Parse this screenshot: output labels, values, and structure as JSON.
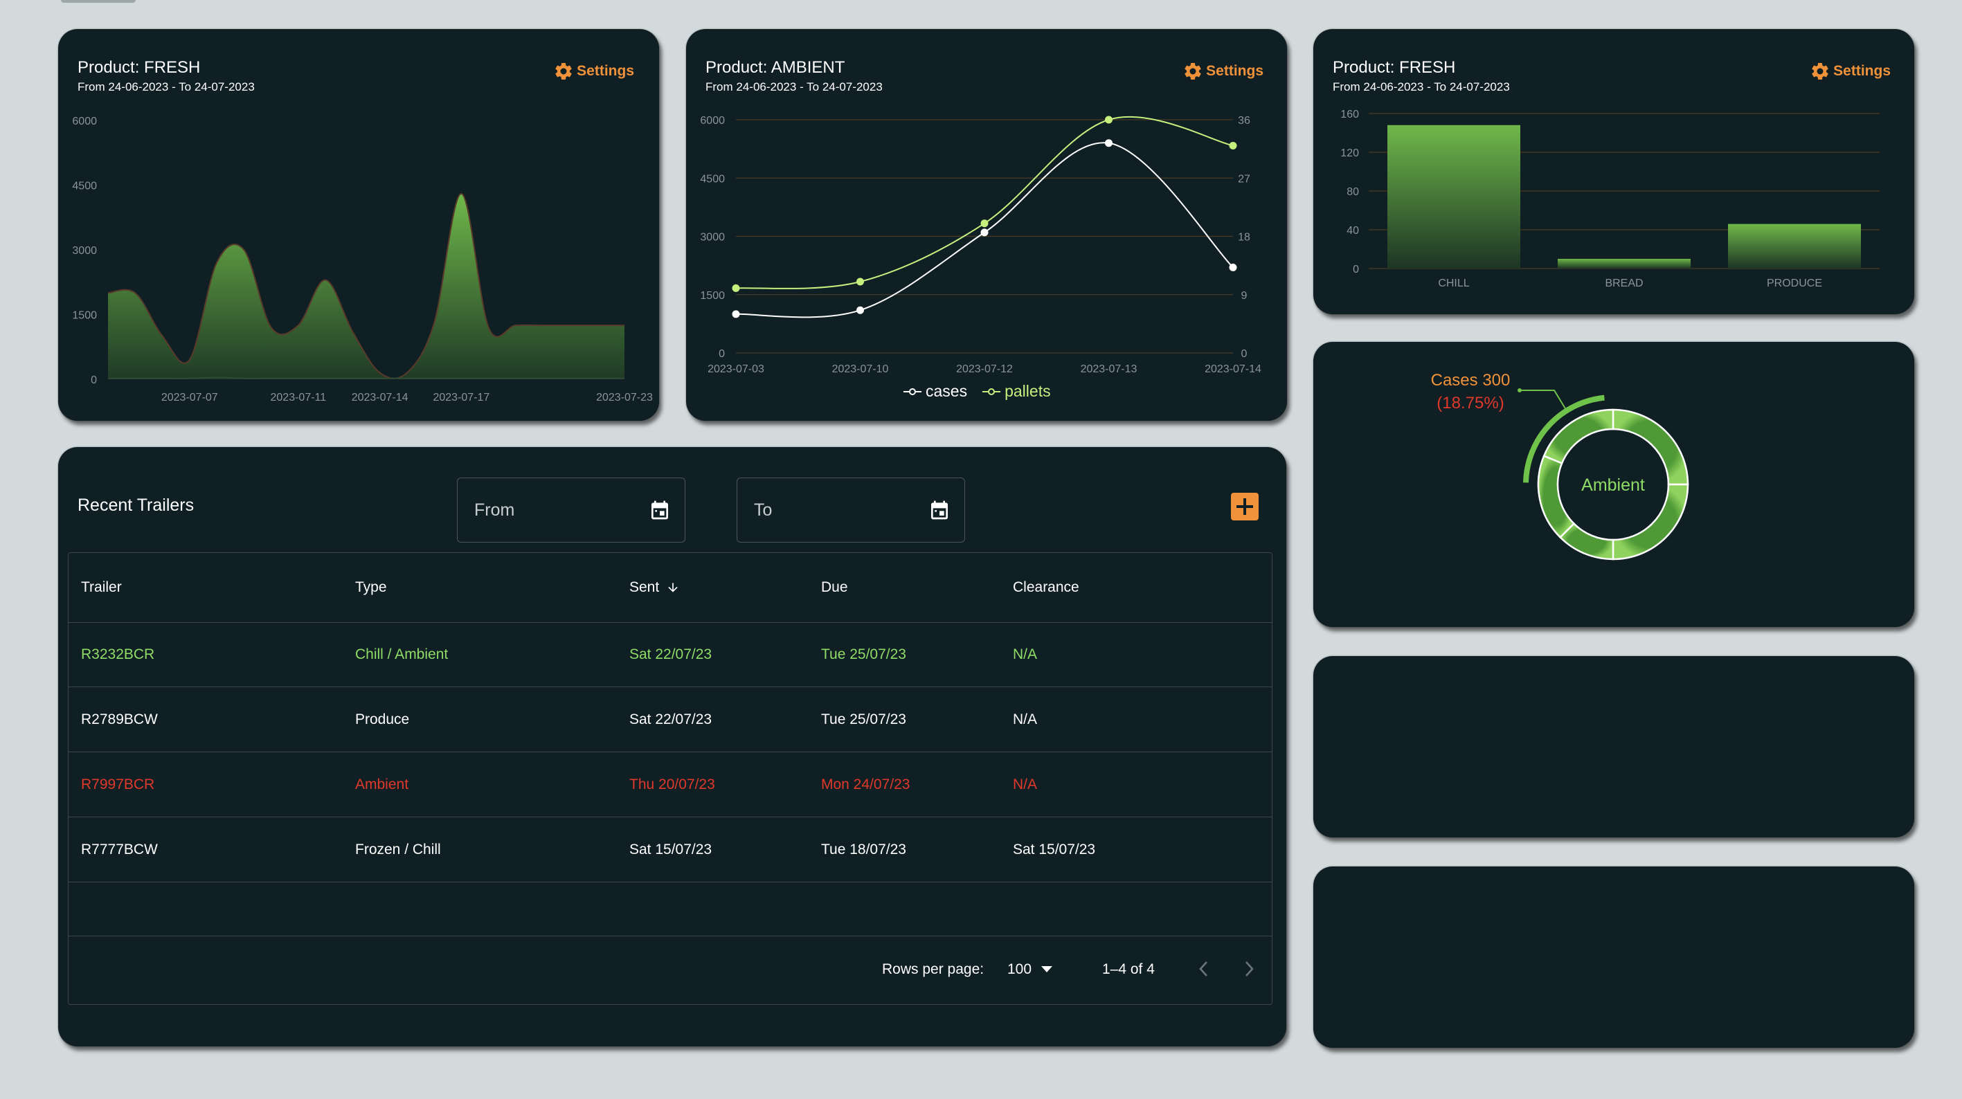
{
  "colors": {
    "page_bg": "#d3dadc",
    "card_bg": "#0f1f24",
    "accent": "#f0923a",
    "green": "#8fdc66",
    "red": "#e0392b",
    "white": "#ffffff"
  },
  "area_card": {
    "title": "Product: FRESH",
    "subtitle": "From 24-06-2023 - To 24-07-2023",
    "settings_label": "Settings",
    "settings_icon": "gear-icon",
    "chart_data": {
      "type": "area",
      "title": "Product: FRESH",
      "ylim": [
        0,
        6000
      ],
      "yticks": [
        0,
        1500,
        3000,
        4500,
        6000
      ],
      "xtick_labels": [
        "2023-07-07",
        "2023-07-11",
        "2023-07-14",
        "2023-07-17",
        "2023-07-23"
      ],
      "x": [
        "2023-07-04",
        "2023-07-05",
        "2023-07-06",
        "2023-07-07",
        "2023-07-08",
        "2023-07-09",
        "2023-07-10",
        "2023-07-11",
        "2023-07-12",
        "2023-07-13",
        "2023-07-14",
        "2023-07-15",
        "2023-07-16",
        "2023-07-17",
        "2023-07-18",
        "2023-07-19",
        "2023-07-20",
        "2023-07-21",
        "2023-07-22",
        "2023-07-23"
      ],
      "series": [
        {
          "values": [
            2000,
            2000,
            1000,
            450,
            2700,
            3000,
            1200,
            1250,
            2300,
            1100,
            150,
            150,
            1300,
            4300,
            1200,
            1250,
            1250,
            1250,
            1250,
            1250
          ]
        },
        {
          "values": [
            20,
            20,
            20,
            20,
            40,
            20,
            20,
            20,
            20,
            20,
            20,
            20,
            20,
            20,
            20,
            20,
            20,
            20,
            20,
            20
          ]
        }
      ],
      "grid": false
    }
  },
  "line_card": {
    "title": "Product: AMBIENT",
    "subtitle": "From 24-06-2023 - To 24-07-2023",
    "settings_label": "Settings",
    "settings_icon": "gear-icon",
    "chart_data": {
      "type": "line",
      "title": "Product: AMBIENT",
      "x": [
        "2023-07-03",
        "2023-07-10",
        "2023-07-12",
        "2023-07-13",
        "2023-07-14"
      ],
      "ylim": [
        0,
        6000
      ],
      "yticks": [
        0,
        1500,
        3000,
        4500,
        6000
      ],
      "y2lim": [
        0,
        36
      ],
      "y2ticks": [
        0,
        9,
        18,
        27,
        36
      ],
      "series": [
        {
          "name": "cases",
          "axis": "left",
          "values": [
            1000,
            1100,
            3100,
            5400,
            2200
          ],
          "color": "#ffffff"
        },
        {
          "name": "pallets",
          "axis": "right",
          "values": [
            10,
            11,
            20,
            36,
            32
          ],
          "color": "#c6f07e"
        }
      ],
      "legend": "bottom",
      "grid": true
    }
  },
  "bar_card": {
    "title": "Product: FRESH",
    "subtitle": "From 24-06-2023 - To 24-07-2023",
    "settings_label": "Settings",
    "settings_icon": "gear-icon",
    "chart_data": {
      "type": "bar",
      "title": "Product: FRESH",
      "categories": [
        "CHILL",
        "BREAD",
        "PRODUCE"
      ],
      "values": [
        148,
        10,
        46
      ],
      "ylim": [
        0,
        160
      ],
      "yticks": [
        0,
        40,
        80,
        120,
        160
      ],
      "grid": true
    }
  },
  "donut_card": {
    "center_label": "Ambient",
    "callout_line1": "Cases 300",
    "callout_line2": "(18.75%)",
    "chart_data": {
      "type": "pie",
      "slices": [
        {
          "name": "",
          "value": 25
        },
        {
          "name": "",
          "value": 25
        },
        {
          "name": "",
          "value": 12.5
        },
        {
          "name": "",
          "value": 18.75
        },
        {
          "name": "",
          "value": 18.75
        }
      ],
      "highlighted": {
        "label": "Cases 300",
        "percent": "(18.75%)"
      }
    }
  },
  "trailers": {
    "title": "Recent Trailers",
    "from_label": "From",
    "to_label": "To",
    "calendar_icon": "calendar-icon",
    "add_icon": "add-box-icon",
    "columns": [
      "Trailer",
      "Type",
      "Sent",
      "Due",
      "Clearance"
    ],
    "sort_icon": "arrow-down-icon",
    "rows": [
      {
        "trailer": "R3232BCR",
        "type": "Chill / Ambient",
        "sent": "Sat 22/07/23",
        "due": "Tue 25/07/23",
        "clearance": "N/A",
        "status_color": "#8fdc66"
      },
      {
        "trailer": "R2789BCW",
        "type": "Produce",
        "sent": "Sat 22/07/23",
        "due": "Tue 25/07/23",
        "clearance": "N/A",
        "status_color": "#ffffff"
      },
      {
        "trailer": "R7997BCR",
        "type": "Ambient",
        "sent": "Thu 20/07/23",
        "due": "Mon 24/07/23",
        "clearance": "N/A",
        "status_color": "#e0392b"
      },
      {
        "trailer": "R7777BCW",
        "type": "Frozen / Chill",
        "sent": "Sat 15/07/23",
        "due": "Tue 18/07/23",
        "clearance": "Sat 15/07/23",
        "status_color": "#ffffff"
      }
    ],
    "footer": {
      "rows_per_page_label": "Rows per page:",
      "rows_per_page_value": "100",
      "range_text": "1–4 of 4"
    }
  }
}
